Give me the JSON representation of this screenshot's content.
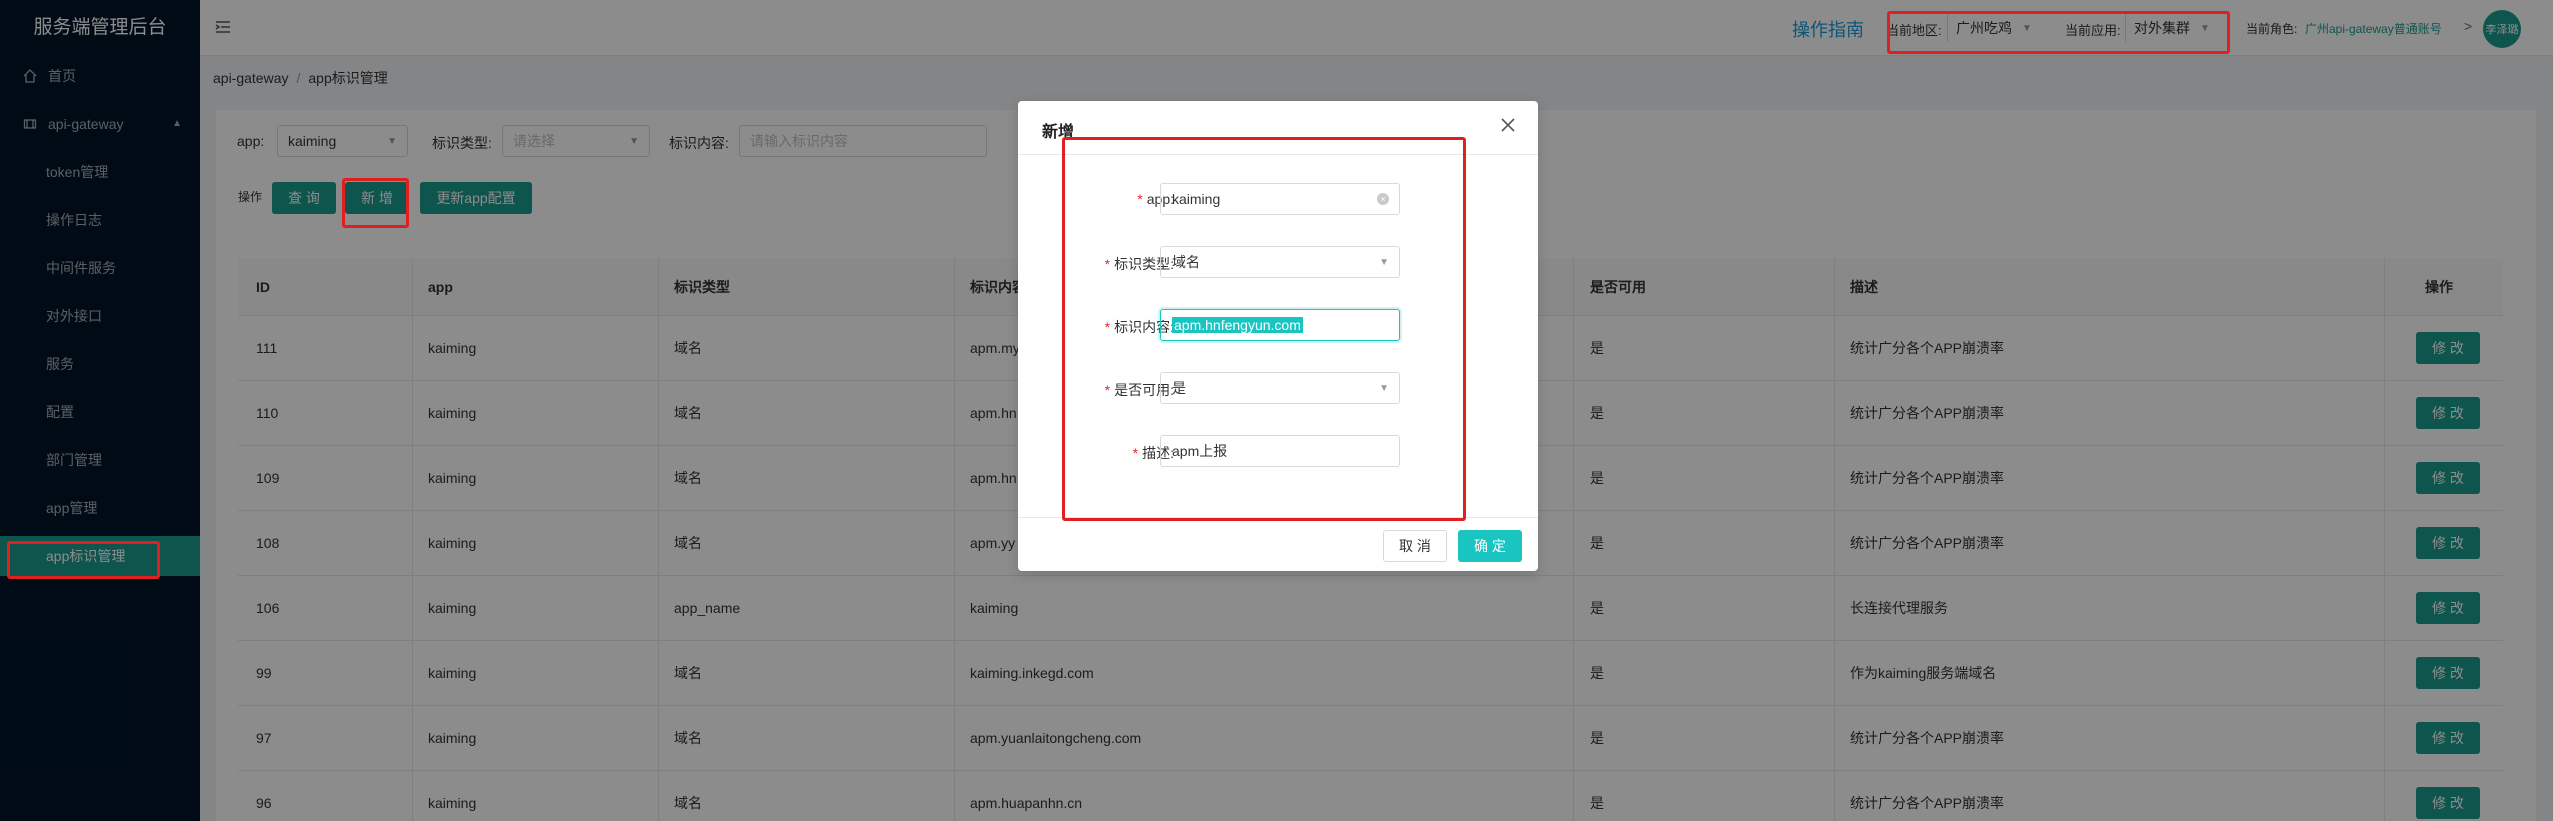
{
  "app_title": "服务端管理后台",
  "sidebar": {
    "items": [
      {
        "label": "首页",
        "icon": "home-icon"
      },
      {
        "label": "api-gateway",
        "icon": "gateway-icon"
      },
      {
        "label": "token管理"
      },
      {
        "label": "操作日志"
      },
      {
        "label": "中间件服务"
      },
      {
        "label": "对外接口"
      },
      {
        "label": "服务"
      },
      {
        "label": "配置"
      },
      {
        "label": "部门管理"
      },
      {
        "label": "app管理"
      },
      {
        "label": "app标识管理"
      }
    ]
  },
  "header": {
    "guide": "操作指南",
    "region_label": "当前地区:",
    "region_value": "广州吃鸡",
    "app_label": "当前应用:",
    "app_value": "对外集群",
    "role_label": "当前角色:",
    "role_value": "广州api-gateway普通账号",
    "avatar_text": "李泽璐"
  },
  "breadcrumb": [
    "api-gateway",
    "app标识管理"
  ],
  "filters": {
    "app_label": "app:",
    "app_value": "kaiming",
    "type_label": "标识类型:",
    "type_placeholder": "请选择",
    "content_label": "标识内容:",
    "content_placeholder": "请输入标识内容"
  },
  "actions": {
    "label": "操作",
    "query": "查 询",
    "add": "新 增",
    "refresh": "更新app配置"
  },
  "table": {
    "headers": [
      "ID",
      "app",
      "标识类型",
      "标识内容",
      "是否可用",
      "描述",
      "操作"
    ],
    "rows": [
      {
        "id": "111",
        "app": "kaiming",
        "type": "域名",
        "content": "apm.my",
        "enabled": "是",
        "desc": "统计广分各个APP崩溃率",
        "action": "修 改"
      },
      {
        "id": "110",
        "app": "kaiming",
        "type": "域名",
        "content": "apm.hn",
        "enabled": "是",
        "desc": "统计广分各个APP崩溃率",
        "action": "修 改"
      },
      {
        "id": "109",
        "app": "kaiming",
        "type": "域名",
        "content": "apm.hn",
        "enabled": "是",
        "desc": "统计广分各个APP崩溃率",
        "action": "修 改"
      },
      {
        "id": "108",
        "app": "kaiming",
        "type": "域名",
        "content": "apm.yy",
        "enabled": "是",
        "desc": "统计广分各个APP崩溃率",
        "action": "修 改"
      },
      {
        "id": "106",
        "app": "kaiming",
        "type": "app_name",
        "content": "kaiming",
        "enabled": "是",
        "desc": "长连接代理服务",
        "action": "修 改"
      },
      {
        "id": "99",
        "app": "kaiming",
        "type": "域名",
        "content": "kaiming.inkegd.com",
        "enabled": "是",
        "desc": "作为kaiming服务端域名",
        "action": "修 改"
      },
      {
        "id": "97",
        "app": "kaiming",
        "type": "域名",
        "content": "apm.yuanlaitongcheng.com",
        "enabled": "是",
        "desc": "统计广分各个APP崩溃率",
        "action": "修 改"
      },
      {
        "id": "96",
        "app": "kaiming",
        "type": "域名",
        "content": "apm.huapanhn.cn",
        "enabled": "是",
        "desc": "统计广分各个APP崩溃率",
        "action": "修 改"
      }
    ]
  },
  "modal": {
    "title": "新增",
    "fields": [
      {
        "label": "app:",
        "value": "kaiming"
      },
      {
        "label": "标识类型:",
        "value": "域名"
      },
      {
        "label": "标识内容:",
        "value": "apm.hnfengyun.com"
      },
      {
        "label": "是否可用:",
        "value": "是"
      },
      {
        "label": "描述:",
        "value": "apm上报"
      }
    ],
    "cancel": "取 消",
    "ok": "确 定"
  },
  "colors": {
    "accent": "#1a9c8f",
    "sidebar_bg": "#001529",
    "annotation": "#e02020"
  }
}
